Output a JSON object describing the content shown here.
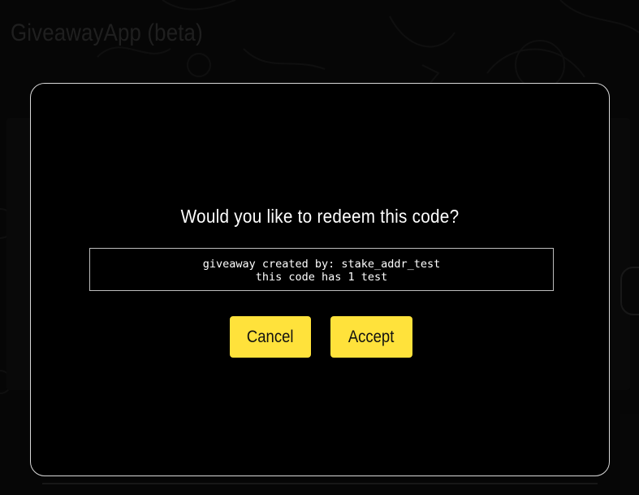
{
  "app": {
    "title": "GiveawayApp (beta)"
  },
  "dialog": {
    "title": "Would you like to redeem this code?",
    "details": {
      "line1": "giveaway created by: stake_addr_test",
      "line2": "this code has 1 test"
    },
    "cancel_label": "Cancel",
    "accept_label": "Accept"
  },
  "colors": {
    "accent": "#ffe23b",
    "modal_bg": "#000000",
    "modal_border": "#d8d8d8",
    "text": "#ffffff"
  }
}
